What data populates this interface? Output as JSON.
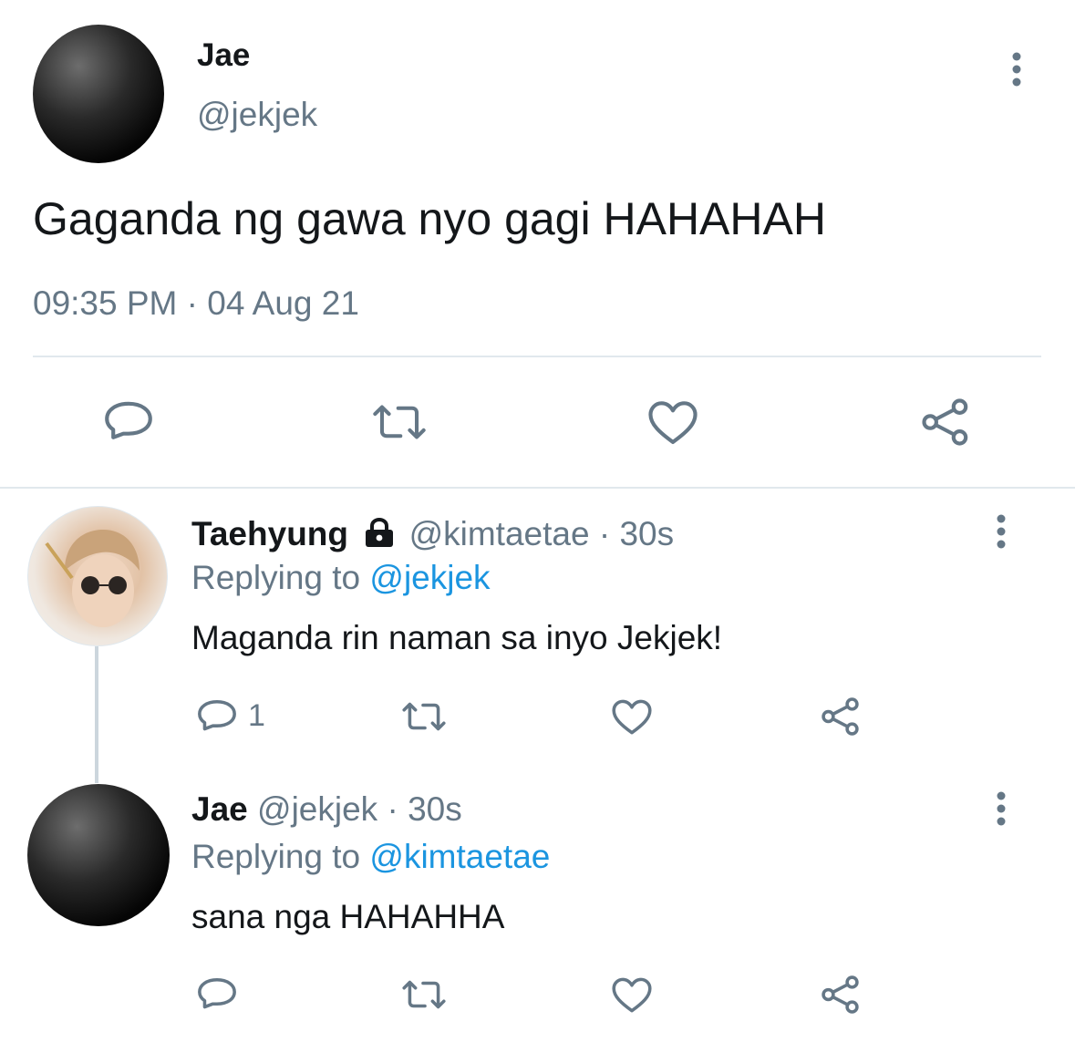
{
  "main_tweet": {
    "name": "Jae",
    "handle": "@jekjek",
    "text": "Gaganda ng gawa nyo gagi HAHAHAH",
    "time": "09:35 PM",
    "separator": "·",
    "date": "04 Aug 21"
  },
  "replies": [
    {
      "name": "Taehyung",
      "handle": "@kimtaetae",
      "sep": "·",
      "age": "30s",
      "replying_prefix": "Replying to",
      "replying_handle": "@jekjek",
      "text": "Maganda rin naman sa inyo Jekjek!",
      "reply_count": "1"
    },
    {
      "name": "Jae",
      "handle": "@jekjek",
      "sep": "·",
      "age": "30s",
      "replying_prefix": "Replying to",
      "replying_handle": "@kimtaetae",
      "text": "sana nga HAHAHHA",
      "reply_count": ""
    }
  ],
  "icons": {
    "more": "more-vertical-icon",
    "reply": "reply-icon",
    "retweet": "retweet-icon",
    "like": "heart-icon",
    "share": "share-icon",
    "lock": "lock-icon"
  },
  "colors": {
    "text": "#14171a",
    "muted": "#657786",
    "link": "#1b95e0",
    "divider": "#e1e8ed"
  }
}
